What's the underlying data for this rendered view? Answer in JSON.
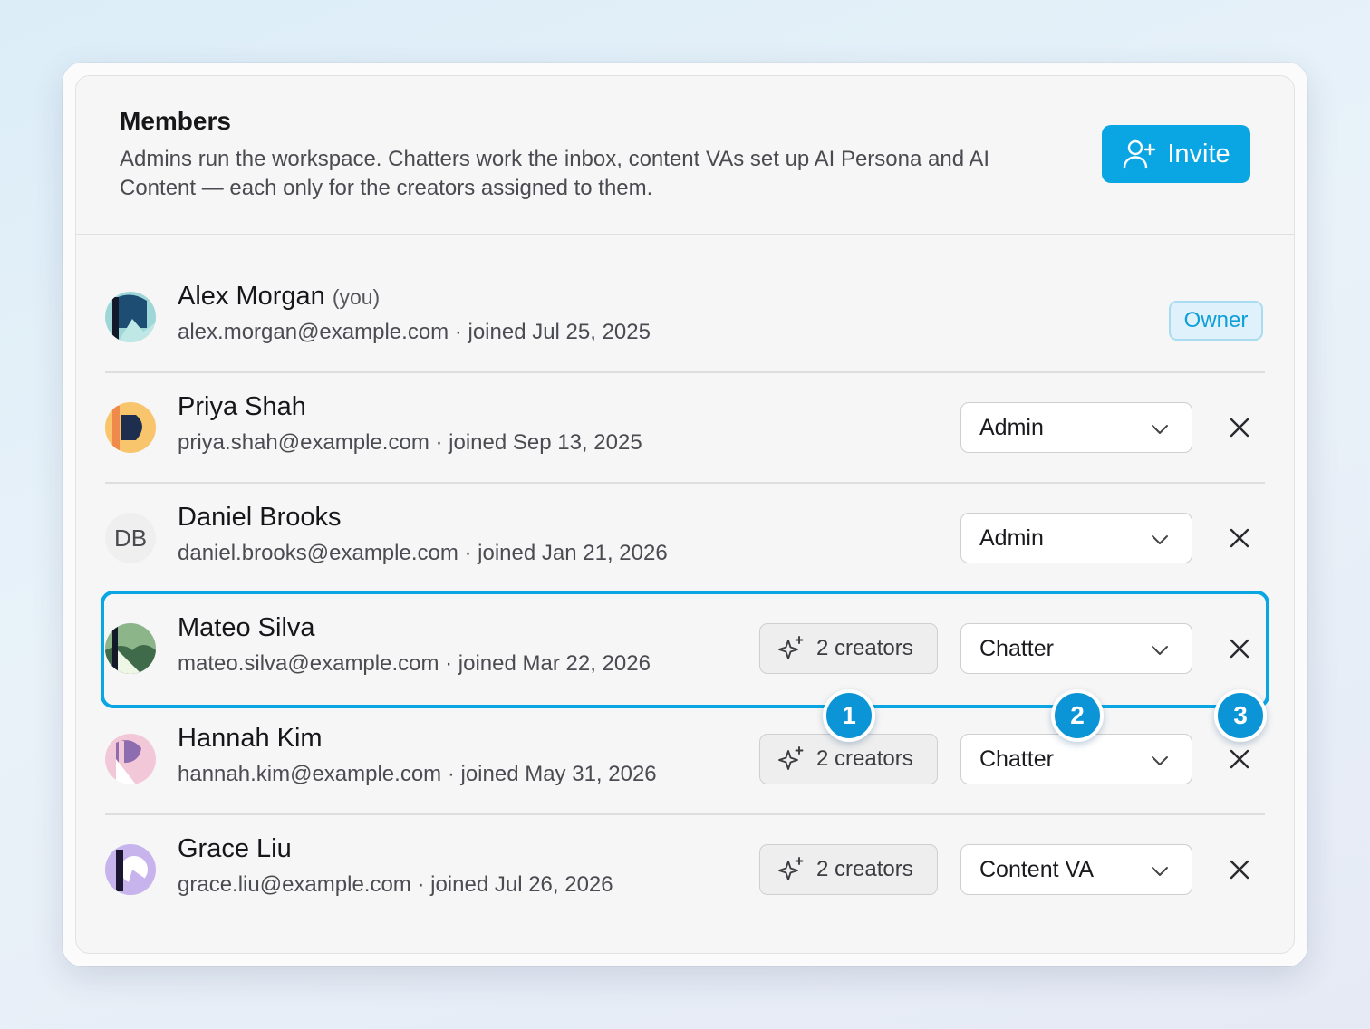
{
  "header": {
    "title": "Members",
    "description": "Admins run the workspace. Chatters work the inbox, content VAs set up AI Persona and AI Content — each only for the creators assigned to them.",
    "invite_label": "Invite"
  },
  "members": [
    {
      "name": "Alex Morgan",
      "you_label": "(you)",
      "meta": "alex.morgan@example.com · joined Jul 25, 2025",
      "badge": "Owner",
      "avatar": "photo"
    },
    {
      "name": "Priya Shah",
      "meta": "priya.shah@example.com · joined Sep 13, 2025",
      "role": "Admin",
      "avatar": "photo"
    },
    {
      "name": "Daniel Brooks",
      "meta": "daniel.brooks@example.com · joined Jan 21, 2026",
      "role": "Admin",
      "avatar_initials": "DB"
    },
    {
      "name": "Mateo Silva",
      "meta": "mateo.silva@example.com · joined Mar 22, 2026",
      "creators": "2 creators",
      "role": "Chatter",
      "avatar": "photo"
    },
    {
      "name": "Hannah Kim",
      "meta": "hannah.kim@example.com · joined May 31, 2026",
      "creators": "2 creators",
      "role": "Chatter",
      "avatar": "photo"
    },
    {
      "name": "Grace Liu",
      "meta": "grace.liu@example.com · joined Jul 26, 2026",
      "creators": "2 creators",
      "role": "Content VA",
      "avatar": "photo"
    }
  ],
  "callouts": [
    "1",
    "2",
    "3"
  ],
  "colors": {
    "accent": "#0aa6e4",
    "callout": "#0b95d6",
    "owner_badge_bg": "#dff1fa"
  },
  "icons": {
    "invite": "user-plus-icon",
    "creators": "sparkles-icon",
    "role": "chevron-down-icon",
    "remove": "close-icon"
  }
}
